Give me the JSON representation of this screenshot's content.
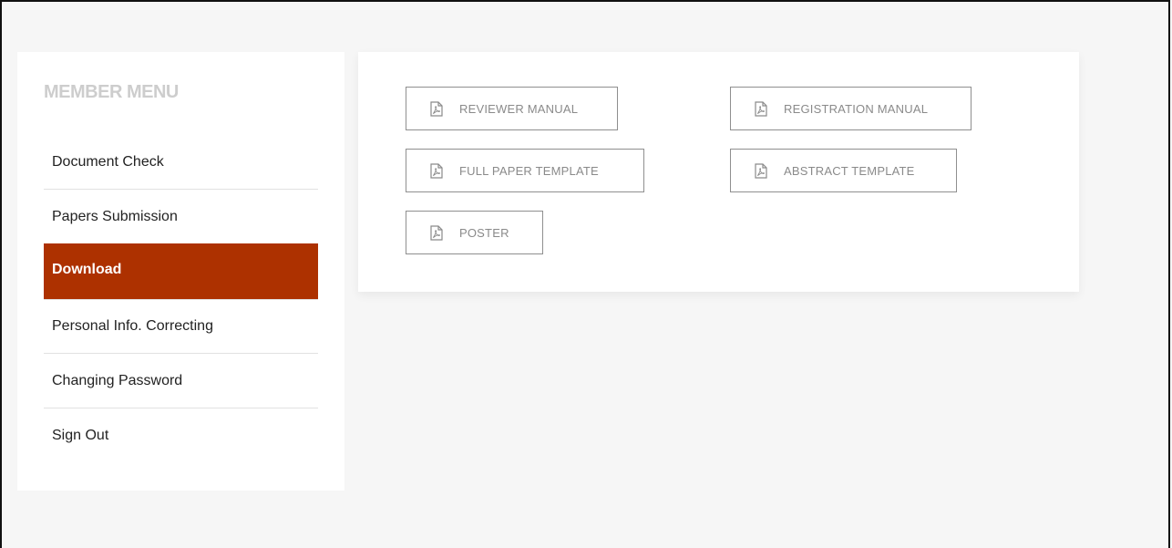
{
  "sidebar": {
    "title": "MEMBER MENU",
    "items": [
      {
        "label": "Document Check",
        "active": false
      },
      {
        "label": "Papers Submission",
        "active": false
      },
      {
        "label": "Download",
        "active": true
      },
      {
        "label": "Personal Info. Correcting",
        "active": false
      },
      {
        "label": "Changing Password",
        "active": false
      },
      {
        "label": "Sign Out",
        "active": false
      }
    ]
  },
  "downloads": {
    "icon": "pdf-file-icon",
    "items": [
      {
        "label": "REVIEWER MANUAL"
      },
      {
        "label": "REGISTRATION MANUAL"
      },
      {
        "label": "FULL PAPER TEMPLATE"
      },
      {
        "label": "ABSTRACT TEMPLATE"
      },
      {
        "label": "POSTER"
      }
    ]
  },
  "colors": {
    "accent": "#ad3100",
    "page_background": "#f6f6f6",
    "menu_title": "#cdcdcd",
    "button_border": "#8f8f8f"
  }
}
